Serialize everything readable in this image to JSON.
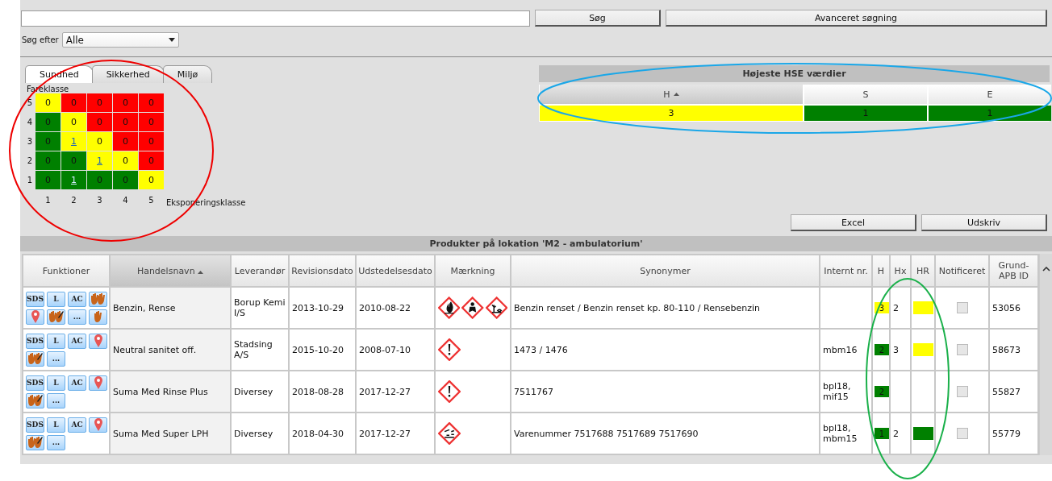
{
  "search": {
    "button": "Søg",
    "advanced_button": "Avanceret søgning",
    "filter_label": "Søg efter",
    "filter_value": "Alle"
  },
  "tabs": [
    {
      "label": "Sundhed",
      "selected": true
    },
    {
      "label": "Sikkerhed",
      "selected": false
    },
    {
      "label": "Miljø",
      "selected": false
    }
  ],
  "matrix": {
    "y_label": "Fareklasse",
    "x_label": "Eksponeringsklasse",
    "x_ticks": [
      "1",
      "2",
      "3",
      "4",
      "5"
    ],
    "rows": [
      {
        "label": "5",
        "cells": [
          {
            "value": "0",
            "color": "#ffff00",
            "link": false
          },
          {
            "value": "0",
            "color": "#ff0000",
            "link": false
          },
          {
            "value": "0",
            "color": "#ff0000",
            "link": false
          },
          {
            "value": "0",
            "color": "#ff0000",
            "link": false
          },
          {
            "value": "0",
            "color": "#ff0000",
            "link": false
          }
        ]
      },
      {
        "label": "4",
        "cells": [
          {
            "value": "0",
            "color": "#008000",
            "link": false
          },
          {
            "value": "0",
            "color": "#ffff00",
            "link": false
          },
          {
            "value": "0",
            "color": "#ff0000",
            "link": false
          },
          {
            "value": "0",
            "color": "#ff0000",
            "link": false
          },
          {
            "value": "0",
            "color": "#ff0000",
            "link": false
          }
        ]
      },
      {
        "label": "3",
        "cells": [
          {
            "value": "0",
            "color": "#008000",
            "link": false
          },
          {
            "value": "1",
            "color": "#ffff00",
            "link": true
          },
          {
            "value": "0",
            "color": "#ffff00",
            "link": false
          },
          {
            "value": "0",
            "color": "#ff0000",
            "link": false
          },
          {
            "value": "0",
            "color": "#ff0000",
            "link": false
          }
        ]
      },
      {
        "label": "2",
        "cells": [
          {
            "value": "0",
            "color": "#008000",
            "link": false
          },
          {
            "value": "0",
            "color": "#008000",
            "link": false
          },
          {
            "value": "1",
            "color": "#ffff00",
            "link": true
          },
          {
            "value": "0",
            "color": "#ffff00",
            "link": false
          },
          {
            "value": "0",
            "color": "#ff0000",
            "link": false
          }
        ]
      },
      {
        "label": "1",
        "cells": [
          {
            "value": "0",
            "color": "#008000",
            "link": false
          },
          {
            "value": "1",
            "color": "#008000",
            "link": true
          },
          {
            "value": "0",
            "color": "#008000",
            "link": false
          },
          {
            "value": "0",
            "color": "#008000",
            "link": false
          },
          {
            "value": "0",
            "color": "#ffff00",
            "link": false
          }
        ]
      }
    ]
  },
  "hse": {
    "title": "Højeste HSE værdier",
    "columns": [
      {
        "label": "H",
        "sorted": true
      },
      {
        "label": "S",
        "sorted": false
      },
      {
        "label": "E",
        "sorted": false
      }
    ],
    "values": [
      {
        "value": "3",
        "color": "#ffff00"
      },
      {
        "value": "1",
        "color": "#008000"
      },
      {
        "value": "1",
        "color": "#008000"
      }
    ]
  },
  "export_buttons": [
    "Excel",
    "Udskriv"
  ],
  "products": {
    "title": "Produkter på lokation 'M2 - ambulatorium'",
    "columns": [
      {
        "label": "Funktioner",
        "sorted": false
      },
      {
        "label": "Handelsnavn",
        "sorted": true
      },
      {
        "label": "Leverandør",
        "sorted": false
      },
      {
        "label": "Revisionsdato",
        "sorted": false
      },
      {
        "label": "Udstedelsesdato",
        "sorted": false
      },
      {
        "label": "Mærkning",
        "sorted": false
      },
      {
        "label": "Synonymer",
        "sorted": false
      },
      {
        "label": "Internt nr.",
        "sorted": false
      },
      {
        "label": "H",
        "sorted": false
      },
      {
        "label": "Hx",
        "sorted": false
      },
      {
        "label": "HR",
        "sorted": false
      },
      {
        "label": "Notificeret",
        "sorted": false
      },
      {
        "label": "Grund-APB ID",
        "sorted": false
      }
    ],
    "rows": [
      {
        "functions": [
          {
            "kind": "text",
            "label": "SDS"
          },
          {
            "kind": "text",
            "label": "L"
          },
          {
            "kind": "text",
            "label": "AC"
          },
          {
            "kind": "hands"
          },
          {
            "kind": "pin"
          },
          {
            "kind": "hands-pen"
          },
          {
            "kind": "text",
            "label": "..."
          },
          {
            "kind": "hand"
          }
        ],
        "name": "Benzin, Rense",
        "supplier": "Borup Kemi I/S",
        "revision": "2013-10-29",
        "issued": "2010-08-22",
        "pictograms": [
          {
            "kind": "flame"
          },
          {
            "kind": "health"
          },
          {
            "kind": "environment"
          }
        ],
        "synonyms": "Benzin renset / Benzin renset kp. 80-110 / Rensebenzin",
        "internal": "",
        "h": {
          "value": "3",
          "color": "#ffff00"
        },
        "hx": "2",
        "hr": {
          "color": "#ffff00"
        },
        "notified": false,
        "apb": "53056"
      },
      {
        "functions": [
          {
            "kind": "text",
            "label": "SDS"
          },
          {
            "kind": "text",
            "label": "L"
          },
          {
            "kind": "text",
            "label": "AC"
          },
          {
            "kind": "pin"
          },
          {
            "kind": "hands-pen"
          },
          {
            "kind": "text",
            "label": "..."
          }
        ],
        "name": "Neutral sanitet off.",
        "supplier": "Stadsing A/S",
        "revision": "2015-10-20",
        "issued": "2008-07-10",
        "pictograms": [
          {
            "kind": "exclamation"
          }
        ],
        "synonyms": "1473 / 1476",
        "internal": "mbm16",
        "h": {
          "value": "2",
          "color": "#008000"
        },
        "hx": "3",
        "hr": {
          "color": "#ffff00"
        },
        "notified": false,
        "apb": "58673"
      },
      {
        "functions": [
          {
            "kind": "text",
            "label": "SDS"
          },
          {
            "kind": "text",
            "label": "L"
          },
          {
            "kind": "text",
            "label": "AC"
          },
          {
            "kind": "pin"
          },
          {
            "kind": "hands-pen"
          },
          {
            "kind": "text",
            "label": "..."
          }
        ],
        "name": "Suma Med Rinse Plus",
        "supplier": "Diversey",
        "revision": "2018-08-28",
        "issued": "2017-12-27",
        "pictograms": [
          {
            "kind": "exclamation"
          }
        ],
        "synonyms": "7511767",
        "internal": "bpl18, mif15",
        "h": {
          "value": "2",
          "color": "#008000"
        },
        "hx": "",
        "hr": null,
        "notified": false,
        "apb": "55827"
      },
      {
        "functions": [
          {
            "kind": "text",
            "label": "SDS"
          },
          {
            "kind": "text",
            "label": "L"
          },
          {
            "kind": "text",
            "label": "AC"
          },
          {
            "kind": "pin"
          },
          {
            "kind": "hands-pen"
          },
          {
            "kind": "text",
            "label": "..."
          }
        ],
        "name": "Suma Med Super LPH",
        "supplier": "Diversey",
        "revision": "2018-04-30",
        "issued": "2017-12-27",
        "pictograms": [
          {
            "kind": "corrosion"
          }
        ],
        "synonyms": "Varenummer 7517688 7517689 7517690",
        "internal": "bpl18, mbm15",
        "h": {
          "value": "1",
          "color": "#008000"
        },
        "hx": "2",
        "hr": {
          "color": "#008000"
        },
        "notified": false,
        "apb": "55779"
      }
    ]
  }
}
